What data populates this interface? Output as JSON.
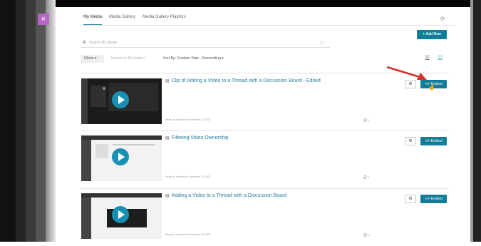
{
  "window": {
    "close_label": "×"
  },
  "tabs": [
    "My Media",
    "Media Gallery",
    "Media Gallery Playlists"
  ],
  "toolbar": {
    "refresh_icon": "refresh-icon",
    "add_new_label": "+ Add New",
    "search_placeholder": "Search My Media",
    "filters_label": "Filters ▾",
    "search_in_label": "Search In: All Fields ▾",
    "sort_label": "Sort By: Creation Date - Descending ▾"
  },
  "entries": [
    {
      "title": "Clip of Adding a Video to a Thread with a Discussion Board - Edited",
      "meta": "Ready to share from December 13, 2022",
      "comments": "0",
      "embed_label": "</> Embed",
      "thumb_bg": "#1b1b1b"
    },
    {
      "title": "Filtering Video Ownership",
      "meta": "Ready to share from December 13, 2022",
      "comments": "0",
      "embed_label": "</> Embed",
      "thumb_bg": "#f2f2f2"
    },
    {
      "title": "Adding a Video to a Thread with a Discussion Board",
      "meta": "Ready to share from December 13, 2022",
      "comments": "0",
      "embed_label": "</> Embed",
      "thumb_bg": "#f2f2f2"
    }
  ],
  "colors": {
    "accent": "#127d97",
    "link": "#2a7fa0",
    "arrow": "#d9302a",
    "close_badge": "#b666c6"
  }
}
